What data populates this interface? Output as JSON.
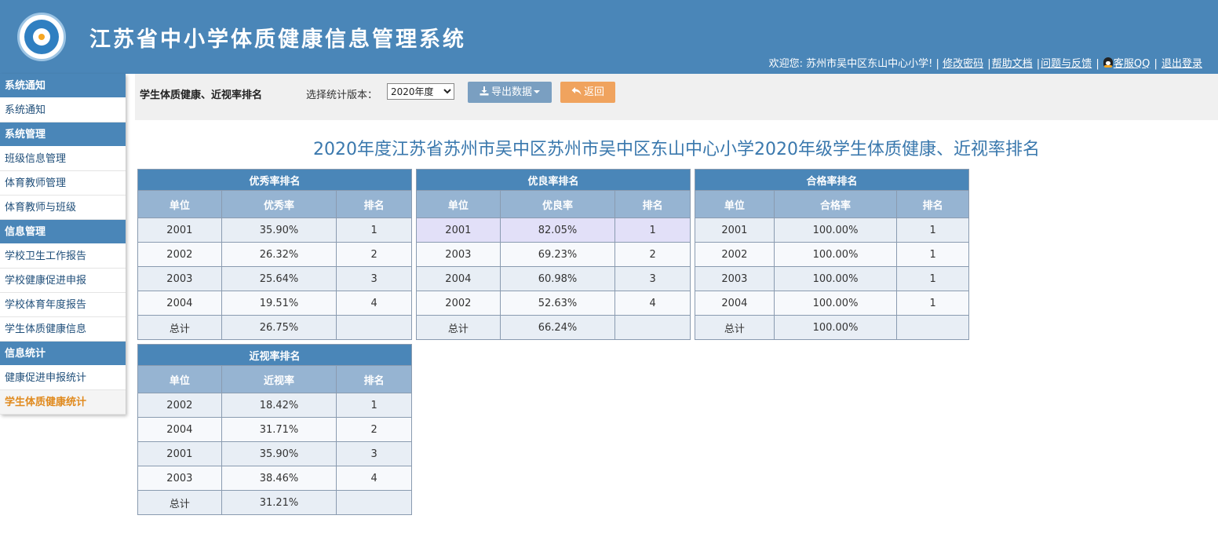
{
  "header": {
    "title": "江苏省中小学体质健康信息管理系统",
    "welcome": "欢迎您: 苏州市吴中区东山中心小学! |",
    "links": [
      "修改密码",
      "帮助文档",
      "问题与反馈"
    ],
    "qq_label": "客服QQ",
    "logout": "退出登录"
  },
  "sidebar": {
    "groups": [
      {
        "title": "系统通知",
        "items": [
          "系统通知"
        ]
      },
      {
        "title": "系统管理",
        "items": [
          "班级信息管理",
          "体育教师管理",
          "体育教师与班级"
        ]
      },
      {
        "title": "信息管理",
        "items": [
          "学校卫生工作报告",
          "学校健康促进申报",
          "学校体育年度报告",
          "学生体质健康信息"
        ]
      },
      {
        "title": "信息统计",
        "items": [
          "健康促进申报统计",
          "学生体质健康统计"
        ]
      }
    ],
    "active_item": "学生体质健康统计"
  },
  "toolbar": {
    "title": "学生体质健康、近视率排名",
    "version_label": "选择统计版本：",
    "version_selected": "2020年度",
    "export_label": "导出数据",
    "back_label": "返回"
  },
  "page_heading": "2020年度江苏省苏州市吴中区苏州市吴中区东山中心小学2020年级学生体质健康、近视率排名",
  "tables": {
    "excellent": {
      "caption": "优秀率排名",
      "columns": [
        "单位",
        "优秀率",
        "排名"
      ],
      "rows": [
        [
          "2001",
          "35.90%",
          "1"
        ],
        [
          "2002",
          "26.32%",
          "2"
        ],
        [
          "2003",
          "25.64%",
          "3"
        ],
        [
          "2004",
          "19.51%",
          "4"
        ]
      ],
      "total": [
        "总计",
        "26.75%",
        ""
      ]
    },
    "good": {
      "caption": "优良率排名",
      "columns": [
        "单位",
        "优良率",
        "排名"
      ],
      "rows": [
        [
          "2001",
          "82.05%",
          "1"
        ],
        [
          "2003",
          "69.23%",
          "2"
        ],
        [
          "2004",
          "60.98%",
          "3"
        ],
        [
          "2002",
          "52.63%",
          "4"
        ]
      ],
      "total": [
        "总计",
        "66.24%",
        ""
      ]
    },
    "pass": {
      "caption": "合格率排名",
      "columns": [
        "单位",
        "合格率",
        "排名"
      ],
      "rows": [
        [
          "2001",
          "100.00%",
          "1"
        ],
        [
          "2002",
          "100.00%",
          "1"
        ],
        [
          "2003",
          "100.00%",
          "1"
        ],
        [
          "2004",
          "100.00%",
          "1"
        ]
      ],
      "total": [
        "总计",
        "100.00%",
        ""
      ]
    },
    "myopia": {
      "caption": "近视率排名",
      "columns": [
        "单位",
        "近视率",
        "排名"
      ],
      "rows": [
        [
          "2002",
          "18.42%",
          "1"
        ],
        [
          "2004",
          "31.71%",
          "2"
        ],
        [
          "2001",
          "35.90%",
          "3"
        ],
        [
          "2003",
          "38.46%",
          "4"
        ]
      ],
      "total": [
        "总计",
        "31.21%",
        ""
      ]
    }
  }
}
